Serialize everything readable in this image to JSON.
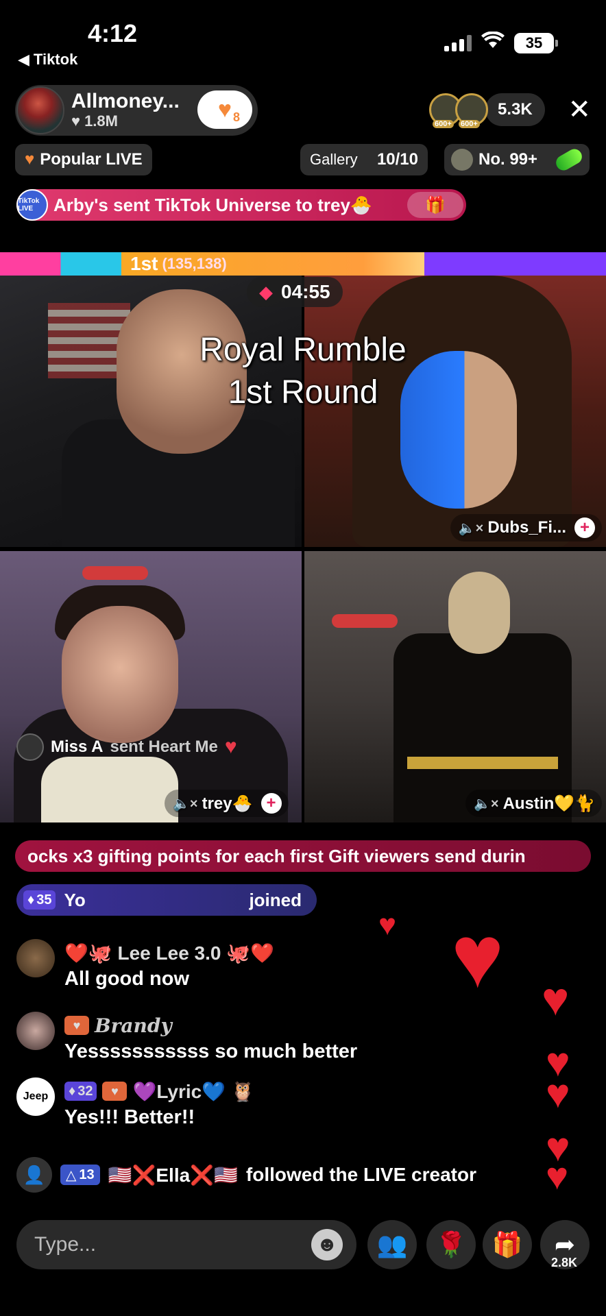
{
  "status": {
    "time": "4:12",
    "back_app": "Tiktok",
    "battery": "35"
  },
  "host": {
    "name": "Allmoney...",
    "likes": "1.8M",
    "fan_level": "8"
  },
  "viewers": {
    "badge1": "600+",
    "badge2": "600+",
    "count": "5.3K"
  },
  "tags": {
    "popular": "Popular LIVE",
    "gallery_label": "Gallery",
    "gallery_count": "10/10",
    "rank": "No. 99+"
  },
  "gift_banner": {
    "icon_text": "TikTok LIVE",
    "text": "Arby's sent TikTok Universe to trey🐣"
  },
  "battle": {
    "rank": "1st",
    "points": "(135,138)",
    "timer": "04:55",
    "title_line1": "Royal Rumble",
    "title_line2": "1st Round"
  },
  "tiles": {
    "top_right_name": "Dubs_Fi...",
    "bottom_left_name": "trey🐣",
    "bottom_right_name": "Austin💛🐈"
  },
  "gift_toast": {
    "user": "Miss A",
    "action": "sent Heart Me"
  },
  "promo": {
    "text": "ocks x3 gifting points for each first Gift viewers send durin"
  },
  "joined": {
    "level": "35",
    "user": "Yo",
    "action": "joined"
  },
  "chat": [
    {
      "name": "❤️🐙 Lee Lee 3.0 🐙❤️",
      "text": "All good now"
    },
    {
      "name": "Brandy",
      "text": "Yesssssssssss so much better"
    },
    {
      "level": "32",
      "name": "💜Lyric💙 🦉",
      "avatar_text": "Jeep",
      "text": "Yes!!! Better!!"
    }
  ],
  "follow_event": {
    "level": "13",
    "name": "🇺🇸❌Ella❌🇺🇸",
    "action": "followed the LIVE creator"
  },
  "bottom": {
    "placeholder": "Type...",
    "share_count": "2.8K"
  }
}
